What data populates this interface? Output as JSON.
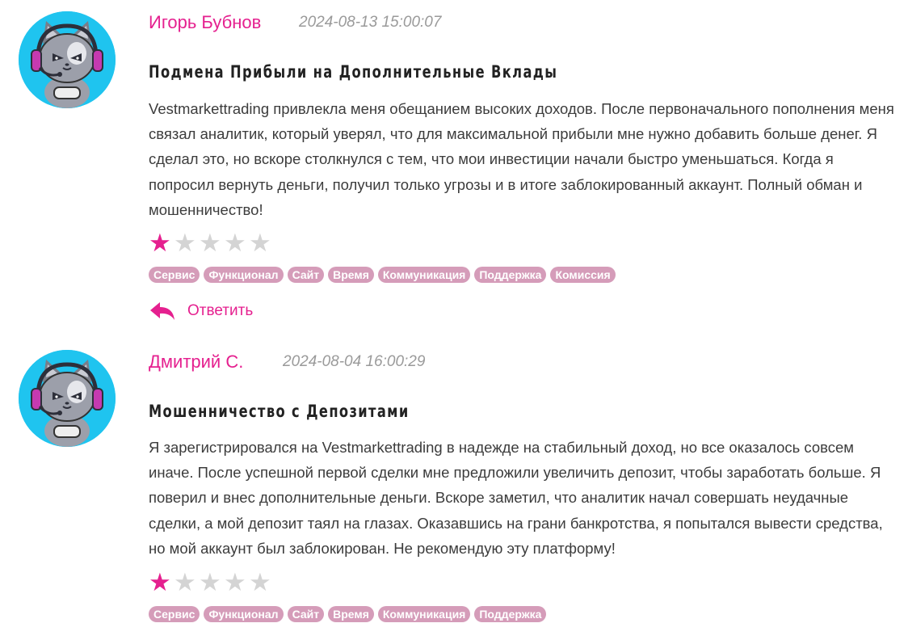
{
  "reviews": [
    {
      "author": "Игорь Бубнов",
      "date": "2024-08-13 15:00:07",
      "title": "Подмена Прибыли на Дополнительные Вклады",
      "text": "Vestmarkettrading привлекла меня обещанием высоких доходов. После первоначального пополнения меня связал аналитик, который уверял, что для максимальной прибыли мне нужно добавить больше денег. Я сделал это, но вскоре столкнулся с тем, что мои инвестиции начали быстро уменьшаться. Когда я попросил вернуть деньги, получил только угрозы и в итоге заблокированный аккаунт. Полный обман и мошенничество!",
      "rating": 1,
      "rating_max": 5,
      "tags": [
        "Сервис",
        "Функционал",
        "Сайт",
        "Время",
        "Коммуникация",
        "Поддержка",
        "Комиссия"
      ],
      "reply_label": "Ответить"
    },
    {
      "author": "Дмитрий С.",
      "date": "2024-08-04 16:00:29",
      "title": "Мошенничество с Депозитами",
      "text": "Я зарегистрировался на Vestmarkettrading в надежде на стабильный доход, но все оказалось совсем иначе. После успешной первой сделки мне предложили увеличить депозит, чтобы заработать больше. Я поверил и внес дополнительные деньги. Вскоре заметил, что аналитик начал совершать неудачные сделки, а мой депозит таял на глазах. Оказавшись на грани банкротства, я попытался вывести средства, но мой аккаунт был заблокирован. Не рекомендую эту платформу!",
      "rating": 1,
      "rating_max": 5,
      "tags": [
        "Сервис",
        "Функционал",
        "Сайт",
        "Время",
        "Коммуникация",
        "Поддержка"
      ]
    }
  ],
  "colors": {
    "accent": "#e5208f",
    "tag_bg": "#d59cb9",
    "star_off": "#d4d4d4",
    "avatar_bg": "#1fc4ef"
  },
  "icons": {
    "avatar": "cat-gamer-avatar-icon",
    "star": "star-icon",
    "reply": "reply-arrow-icon"
  }
}
